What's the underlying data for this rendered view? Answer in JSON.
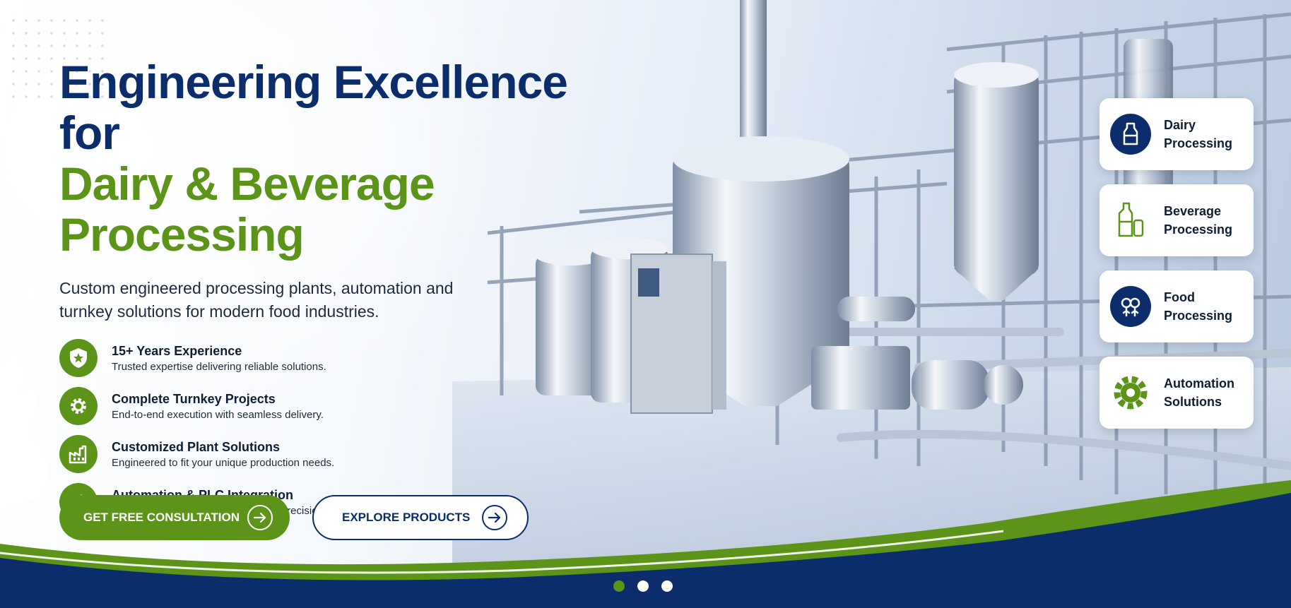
{
  "hero": {
    "title_line1": "Engineering Excellence for",
    "title_line2": "Dairy & Beverage",
    "title_line3": "Processing",
    "subtitle": "Custom engineered processing plants, automation and turnkey solutions for modern food industries."
  },
  "features": [
    {
      "title": "15+ Years Experience",
      "desc": "Trusted expertise delivering reliable solutions.",
      "icon": "shield-star-icon"
    },
    {
      "title": "Complete Turnkey Projects",
      "desc": "End-to-end execution with seamless delivery.",
      "icon": "gear-icon"
    },
    {
      "title": "Customized Plant Solutions",
      "desc": "Engineered to fit your unique production needs.",
      "icon": "factory-icon"
    },
    {
      "title": "Automation & PLC Integration",
      "desc": "Smart automation for efficiency and precision.",
      "icon": "robot-arm-icon"
    }
  ],
  "cta": {
    "primary_label": "GET FREE CONSULTATION",
    "secondary_label": "EXPLORE PRODUCTS"
  },
  "categories": [
    {
      "label": "Dairy\nProcessing",
      "icon": "milk-bottle-icon"
    },
    {
      "label": "Beverage\nProcessing",
      "icon": "bottle-can-icon"
    },
    {
      "label": "Food\nProcessing",
      "icon": "food-icon"
    },
    {
      "label": "Automation\nSolutions",
      "icon": "gear-icon"
    }
  ],
  "carousel": {
    "slides": 3,
    "active_index": 0
  },
  "colors": {
    "navy": "#0b2d6b",
    "green": "#5b9418",
    "white": "#ffffff"
  }
}
